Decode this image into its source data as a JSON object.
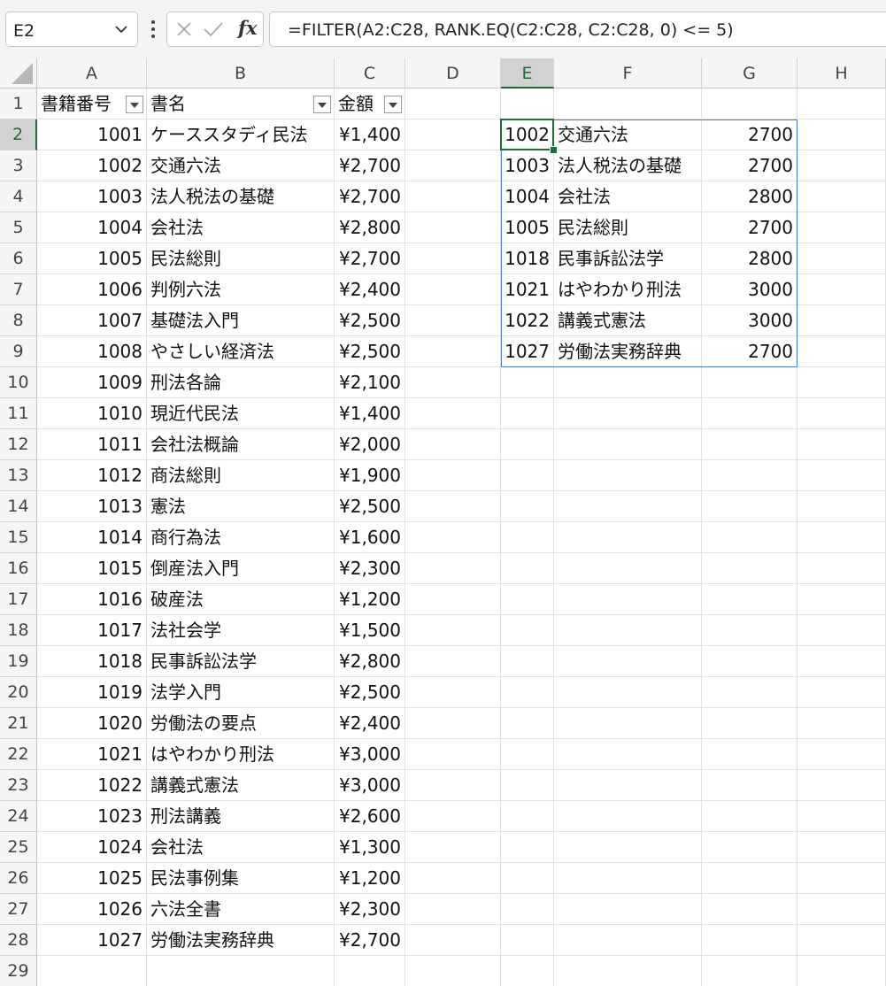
{
  "name_box": {
    "value": "E2"
  },
  "formula_bar": {
    "fx_label": "fx",
    "formula": "=FILTER(A2:C28, RANK.EQ(C2:C28, C2:C28, 0) <= 5)"
  },
  "columns": [
    "A",
    "B",
    "C",
    "D",
    "E",
    "F",
    "G",
    "H"
  ],
  "selected_column": "E",
  "selected_row": "2",
  "rows": [
    "1",
    "2",
    "3",
    "4",
    "5",
    "6",
    "7",
    "8",
    "9",
    "10",
    "11",
    "12",
    "13",
    "14",
    "15",
    "16",
    "17",
    "18",
    "19",
    "20",
    "21",
    "22",
    "23",
    "24",
    "25",
    "26",
    "27",
    "28",
    "29"
  ],
  "table": {
    "headers": [
      "書籍番号",
      "書名",
      "金額"
    ],
    "records": [
      [
        "1001",
        "ケーススタディ民法",
        "¥1,400"
      ],
      [
        "1002",
        "交通六法",
        "¥2,700"
      ],
      [
        "1003",
        "法人税法の基礎",
        "¥2,700"
      ],
      [
        "1004",
        "会社法",
        "¥2,800"
      ],
      [
        "1005",
        "民法総則",
        "¥2,700"
      ],
      [
        "1006",
        "判例六法",
        "¥2,400"
      ],
      [
        "1007",
        "基礎法入門",
        "¥2,500"
      ],
      [
        "1008",
        "やさしい経済法",
        "¥2,500"
      ],
      [
        "1009",
        "刑法各論",
        "¥2,100"
      ],
      [
        "1010",
        "現近代民法",
        "¥1,400"
      ],
      [
        "1011",
        "会社法概論",
        "¥2,000"
      ],
      [
        "1012",
        "商法総則",
        "¥1,900"
      ],
      [
        "1013",
        "憲法",
        "¥2,500"
      ],
      [
        "1014",
        "商行為法",
        "¥1,600"
      ],
      [
        "1015",
        "倒産法入門",
        "¥2,300"
      ],
      [
        "1016",
        "破産法",
        "¥1,200"
      ],
      [
        "1017",
        "法社会学",
        "¥1,500"
      ],
      [
        "1018",
        "民事訴訟法学",
        "¥2,800"
      ],
      [
        "1019",
        "法学入門",
        "¥2,500"
      ],
      [
        "1020",
        "労働法の要点",
        "¥2,400"
      ],
      [
        "1021",
        "はやわかり刑法",
        "¥3,000"
      ],
      [
        "1022",
        "講義式憲法",
        "¥3,000"
      ],
      [
        "1023",
        "刑法講義",
        "¥2,600"
      ],
      [
        "1024",
        "会社法",
        "¥1,300"
      ],
      [
        "1025",
        "民法事例集",
        "¥1,200"
      ],
      [
        "1026",
        "六法全書",
        "¥2,300"
      ],
      [
        "1027",
        "労働法実務辞典",
        "¥2,700"
      ]
    ]
  },
  "filter_result": [
    [
      "1002",
      "交通六法",
      "2700"
    ],
    [
      "1003",
      "法人税法の基礎",
      "2700"
    ],
    [
      "1004",
      "会社法",
      "2800"
    ],
    [
      "1005",
      "民法総則",
      "2700"
    ],
    [
      "1018",
      "民事訴訟法学",
      "2800"
    ],
    [
      "1021",
      "はやわかり刑法",
      "3000"
    ],
    [
      "1022",
      "講義式憲法",
      "3000"
    ],
    [
      "1027",
      "労働法実務辞典",
      "2700"
    ]
  ]
}
